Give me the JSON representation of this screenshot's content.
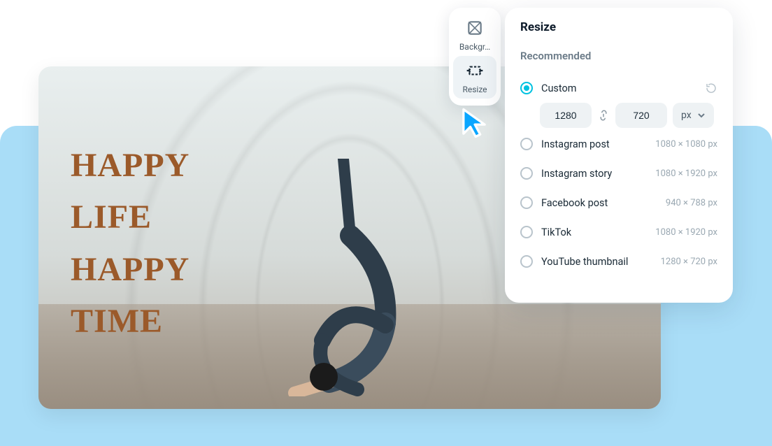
{
  "canvas": {
    "overlay_lines": [
      "HAPPY",
      "LIFE",
      "HAPPY",
      "TIME"
    ]
  },
  "toolbar": {
    "background_label": "Backgr…",
    "resize_label": "Resize"
  },
  "panel": {
    "title": "Resize",
    "section": "Recommended",
    "custom_label": "Custom",
    "width_value": "1280",
    "height_value": "720",
    "unit_label": "px",
    "options": [
      {
        "name": "Instagram post",
        "dim": "1080 × 1080 px"
      },
      {
        "name": "Instagram story",
        "dim": "1080 × 1920 px"
      },
      {
        "name": "Facebook post",
        "dim": "940 × 788 px"
      },
      {
        "name": "TikTok",
        "dim": "1080 × 1920 px"
      },
      {
        "name": "YouTube thumbnail",
        "dim": "1280 × 720 px"
      }
    ]
  }
}
